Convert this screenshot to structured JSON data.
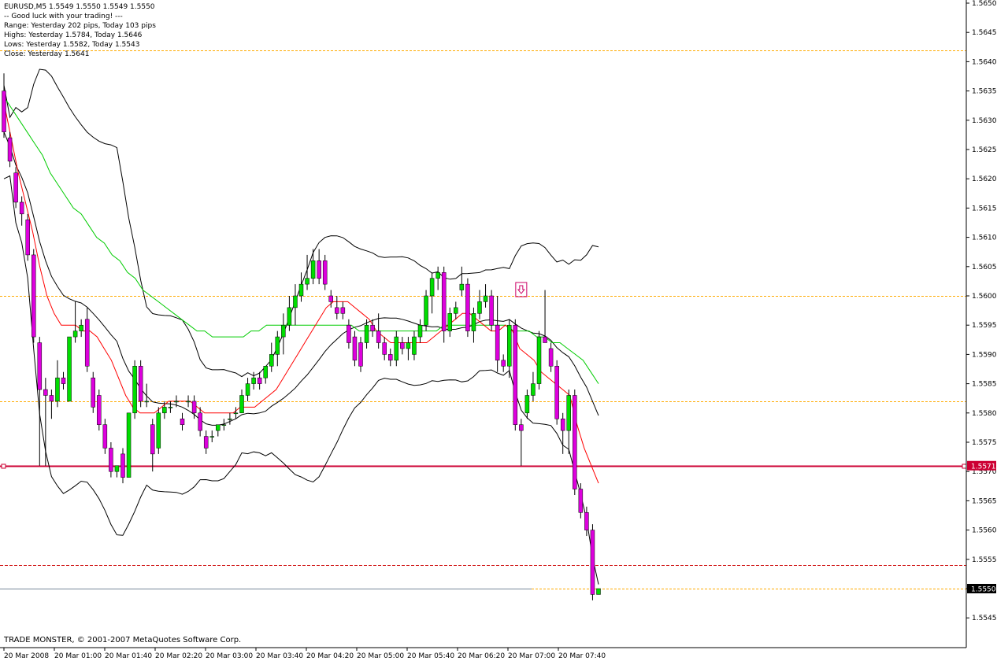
{
  "info": {
    "symbol_line": "EURUSD,M5  1.5549 1.5550 1.5549 1.5550",
    "lines": [
      "-- Good luck with your trading! ---",
      "Range: Yesterday 202 pips, Today 103 pips",
      "Highs: Yesterday 1.5784, Today 1.5646",
      "Lows:  Yesterday 1.5582, Today 1.5543",
      "Close: Yesterday 1.5641"
    ]
  },
  "copyright": "TRADE MONSTER, © 2001-2007 MetaQuotes Software Corp.",
  "colors": {
    "bull": "#00dd00",
    "bear": "#dd00dd",
    "wick": "#000000",
    "ma_fast": "#ff0000",
    "ma_slow": "#00cc00",
    "bands": "#000000",
    "level_orange": "#ffaa00",
    "level_red": "#cc0033",
    "level_dash_red": "#cc0000"
  },
  "chart_data": {
    "type": "candlestick",
    "ylim": [
      1.5541,
      1.5651
    ],
    "y_ticks": [
      "1.5650",
      "1.5645",
      "1.5640",
      "1.5635",
      "1.5630",
      "1.5625",
      "1.5620",
      "1.5615",
      "1.5610",
      "1.5605",
      "1.5600",
      "1.5595",
      "1.5590",
      "1.5585",
      "1.5580",
      "1.5575",
      "1.5570",
      "1.5565",
      "1.5560",
      "1.5555",
      "1.5550",
      "1.5545"
    ],
    "x_ticks": [
      "20 Mar 2008",
      "20 Mar 01:00",
      "20 Mar 01:40",
      "20 Mar 02:20",
      "20 Mar 03:00",
      "20 Mar 03:40",
      "20 Mar 04:20",
      "20 Mar 05:00",
      "20 Mar 05:40",
      "20 Mar 06:20",
      "20 Mar 07:00",
      "20 Mar 07:40"
    ],
    "horizontal_levels": [
      {
        "price": 1.5642,
        "style": "dotted-orange"
      },
      {
        "price": 1.56,
        "style": "dotted-orange"
      },
      {
        "price": 1.5582,
        "style": "dotted-orange"
      },
      {
        "price": 1.5571,
        "style": "solid-red",
        "label": "1.5571"
      },
      {
        "price": 1.5554,
        "style": "dashed-red"
      },
      {
        "price": 1.555,
        "style": "dotted-orange",
        "label": "1.5550"
      }
    ],
    "bid_line": 1.555,
    "candles": [
      [
        1.5635,
        1.5638,
        1.5627,
        1.5628
      ],
      [
        1.5627,
        1.5628,
        1.5622,
        1.5623
      ],
      [
        1.5621,
        1.5622,
        1.5615,
        1.5616
      ],
      [
        1.5616,
        1.5617,
        1.5612,
        1.5614
      ],
      [
        1.5613,
        1.5614,
        1.5606,
        1.5607
      ],
      [
        1.5607,
        1.5608,
        1.5592,
        1.5593
      ],
      [
        1.5592,
        1.5593,
        1.5571,
        1.5584
      ],
      [
        1.5584,
        1.5586,
        1.5571,
        1.5583
      ],
      [
        1.5583,
        1.5584,
        1.5579,
        1.5582
      ],
      [
        1.5582,
        1.5589,
        1.5581,
        1.5586
      ],
      [
        1.5586,
        1.5587,
        1.5584,
        1.5585
      ],
      [
        1.5582,
        1.5592,
        1.5582,
        1.5593
      ],
      [
        1.5593,
        1.5599,
        1.5592,
        1.5594
      ],
      [
        1.5594,
        1.5596,
        1.5593,
        1.5595
      ],
      [
        1.5596,
        1.5598,
        1.5587,
        1.5588
      ],
      [
        1.5586,
        1.5587,
        1.558,
        1.5581
      ],
      [
        1.5583,
        1.5584,
        1.5577,
        1.5578
      ],
      [
        1.5578,
        1.5579,
        1.5573,
        1.5574
      ],
      [
        1.5574,
        1.5575,
        1.5569,
        1.557
      ],
      [
        1.557,
        1.5571,
        1.5569,
        1.5571
      ],
      [
        1.5573,
        1.5574,
        1.5568,
        1.5569
      ],
      [
        1.5569,
        1.558,
        1.5569,
        1.558
      ],
      [
        1.558,
        1.5589,
        1.5579,
        1.5588
      ],
      [
        1.5588,
        1.5589,
        1.5581,
        1.5582
      ],
      [
        1.5582,
        1.5585,
        1.5581,
        1.5582
      ],
      [
        1.5578,
        1.5579,
        1.557,
        1.5573
      ],
      [
        1.5574,
        1.5581,
        1.5573,
        1.558
      ],
      [
        1.558,
        1.5582,
        1.5579,
        1.5581
      ],
      [
        1.5581,
        1.5582,
        1.558,
        1.5581
      ],
      [
        1.5582,
        1.5583,
        1.5581,
        1.5582
      ],
      [
        1.5579,
        1.558,
        1.5577,
        1.5578
      ],
      [
        1.5582,
        1.5583,
        1.5581,
        1.5582
      ],
      [
        1.5582,
        1.5583,
        1.5579,
        1.558
      ],
      [
        1.558,
        1.5581,
        1.5576,
        1.5577
      ],
      [
        1.5576,
        1.5577,
        1.5573,
        1.5574
      ],
      [
        1.5576,
        1.5577,
        1.5575,
        1.5576
      ],
      [
        1.5577,
        1.5578,
        1.5576,
        1.5578
      ],
      [
        1.5578,
        1.5579,
        1.5577,
        1.5578
      ],
      [
        1.5579,
        1.558,
        1.5578,
        1.5579
      ],
      [
        1.558,
        1.5581,
        1.5579,
        1.558
      ],
      [
        1.558,
        1.5584,
        1.558,
        1.5583
      ],
      [
        1.5583,
        1.5586,
        1.5582,
        1.5585
      ],
      [
        1.5585,
        1.5587,
        1.5584,
        1.5586
      ],
      [
        1.5586,
        1.5587,
        1.5584,
        1.5585
      ],
      [
        1.5586,
        1.5588,
        1.5585,
        1.5588
      ],
      [
        1.5588,
        1.5592,
        1.5587,
        1.559
      ],
      [
        1.559,
        1.5594,
        1.5588,
        1.5593
      ],
      [
        1.5593,
        1.5597,
        1.559,
        1.5595
      ],
      [
        1.5595,
        1.56,
        1.5594,
        1.5598
      ],
      [
        1.5598,
        1.5602,
        1.5595,
        1.56
      ],
      [
        1.56,
        1.5604,
        1.5599,
        1.5602
      ],
      [
        1.5602,
        1.5607,
        1.5601,
        1.5603
      ],
      [
        1.5603,
        1.5608,
        1.5602,
        1.5606
      ],
      [
        1.5606,
        1.5608,
        1.5602,
        1.5603
      ],
      [
        1.5606,
        1.5607,
        1.5601,
        1.5602
      ],
      [
        1.56,
        1.5601,
        1.5598,
        1.5599
      ],
      [
        1.5598,
        1.56,
        1.5596,
        1.5597
      ],
      [
        1.5598,
        1.5599,
        1.5596,
        1.5597
      ],
      [
        1.5595,
        1.5596,
        1.5591,
        1.5592
      ],
      [
        1.5593,
        1.5594,
        1.5588,
        1.5589
      ],
      [
        1.5592,
        1.5593,
        1.5587,
        1.5588
      ],
      [
        1.5592,
        1.5596,
        1.5591,
        1.5595
      ],
      [
        1.5595,
        1.5596,
        1.5593,
        1.5594
      ],
      [
        1.5594,
        1.5597,
        1.5591,
        1.5592
      ],
      [
        1.5592,
        1.5593,
        1.5589,
        1.559
      ],
      [
        1.559,
        1.5591,
        1.5588,
        1.5589
      ],
      [
        1.5589,
        1.5594,
        1.5588,
        1.5593
      ],
      [
        1.5592,
        1.5593,
        1.559,
        1.5591
      ],
      [
        1.5591,
        1.5593,
        1.5589,
        1.5592
      ],
      [
        1.559,
        1.5594,
        1.5589,
        1.5593
      ],
      [
        1.5593,
        1.5596,
        1.5592,
        1.5595
      ],
      [
        1.5595,
        1.5601,
        1.5594,
        1.56
      ],
      [
        1.56,
        1.5604,
        1.5597,
        1.5603
      ],
      [
        1.5603,
        1.5605,
        1.5601,
        1.5604
      ],
      [
        1.5604,
        1.5605,
        1.5592,
        1.5594
      ],
      [
        1.5594,
        1.5598,
        1.5593,
        1.5597
      ],
      [
        1.5597,
        1.5599,
        1.5596,
        1.5598
      ],
      [
        1.5601,
        1.5605,
        1.56,
        1.5602
      ],
      [
        1.5602,
        1.5603,
        1.5593,
        1.5594
      ],
      [
        1.5594,
        1.5598,
        1.5592,
        1.5597
      ],
      [
        1.5597,
        1.5601,
        1.5596,
        1.5599
      ],
      [
        1.5599,
        1.5602,
        1.5598,
        1.56
      ],
      [
        1.56,
        1.5601,
        1.5594,
        1.5595
      ],
      [
        1.5595,
        1.56,
        1.5587,
        1.5589
      ],
      [
        1.5589,
        1.559,
        1.5587,
        1.5588
      ],
      [
        1.5588,
        1.5596,
        1.5586,
        1.5595
      ],
      [
        1.5595,
        1.5596,
        1.5577,
        1.5578
      ],
      [
        1.5578,
        1.5579,
        1.5571,
        1.5577
      ],
      [
        1.558,
        1.5584,
        1.5579,
        1.5583
      ],
      [
        1.5583,
        1.5587,
        1.5582,
        1.5585
      ],
      [
        1.5585,
        1.5594,
        1.5584,
        1.5593
      ],
      [
        1.5593,
        1.5601,
        1.5592,
        1.5592
      ],
      [
        1.5591,
        1.5592,
        1.5587,
        1.5588
      ],
      [
        1.5588,
        1.5589,
        1.5578,
        1.5579
      ],
      [
        1.5579,
        1.558,
        1.5573,
        1.5577
      ],
      [
        1.5577,
        1.5584,
        1.5573,
        1.5583
      ],
      [
        1.5583,
        1.5584,
        1.5566,
        1.5567
      ],
      [
        1.5567,
        1.5568,
        1.5562,
        1.5563
      ],
      [
        1.5563,
        1.5564,
        1.5559,
        1.556
      ],
      [
        1.556,
        1.5561,
        1.5548,
        1.5549
      ],
      [
        1.5549,
        1.555,
        1.5549,
        1.555
      ]
    ],
    "ma_fast": [
      1.5633,
      1.5627,
      1.5621,
      1.5616,
      1.5611,
      1.5605,
      1.56,
      1.5597,
      1.5595,
      1.5595,
      1.5595,
      1.5594,
      1.5594,
      1.5593,
      1.5591,
      1.5589,
      1.5586,
      1.5583,
      1.5581,
      1.558,
      1.558,
      1.558,
      1.5581,
      1.5582,
      1.5582,
      1.5582,
      1.5582,
      1.5581,
      1.558,
      1.558,
      1.558,
      1.558,
      1.558,
      1.5581,
      1.5581,
      1.5581,
      1.5582,
      1.5583,
      1.5584,
      1.5586,
      1.5588,
      1.559,
      1.5592,
      1.5594,
      1.5596,
      1.5598,
      1.5599,
      1.5599,
      1.5599,
      1.5598,
      1.5597,
      1.5596,
      1.5594,
      1.5593,
      1.5592,
      1.5592,
      1.5592,
      1.5592,
      1.5592,
      1.5592,
      1.5593,
      1.5594,
      1.5595,
      1.5596,
      1.5597,
      1.5597,
      1.5596,
      1.5595,
      1.5594,
      1.5594,
      1.5595,
      1.5594,
      1.5591,
      1.559,
      1.5589,
      1.5587,
      1.5586,
      1.5585,
      1.5584,
      1.5583,
      1.5578,
      1.5574,
      1.5571,
      1.5568
    ],
    "ma_slow": [
      1.5634,
      1.5632,
      1.563,
      1.5628,
      1.5626,
      1.5624,
      1.5621,
      1.5619,
      1.5617,
      1.5615,
      1.5614,
      1.5612,
      1.561,
      1.5609,
      1.5607,
      1.5606,
      1.5604,
      1.5603,
      1.5601,
      1.56,
      1.5599,
      1.5598,
      1.5597,
      1.5596,
      1.5595,
      1.5594,
      1.5594,
      1.5593,
      1.5593,
      1.5593,
      1.5593,
      1.5593,
      1.5594,
      1.5594,
      1.5595,
      1.5595,
      1.5595,
      1.5595,
      1.5595,
      1.5595,
      1.5595,
      1.5595,
      1.5595,
      1.5595,
      1.5595,
      1.5595,
      1.5594,
      1.5594,
      1.5594,
      1.5594,
      1.5594,
      1.5594,
      1.5594,
      1.5594,
      1.5594,
      1.5594,
      1.5594,
      1.5595,
      1.5595,
      1.5595,
      1.5595,
      1.5595,
      1.5595,
      1.5595,
      1.5595,
      1.5595,
      1.5594,
      1.5594,
      1.5594,
      1.5593,
      1.5593,
      1.5592,
      1.5592,
      1.5591,
      1.559,
      1.5589,
      1.5587,
      1.5585
    ]
  },
  "markers": [
    {
      "type": "arrow-down-box",
      "candle": 87,
      "price": 1.56
    }
  ]
}
